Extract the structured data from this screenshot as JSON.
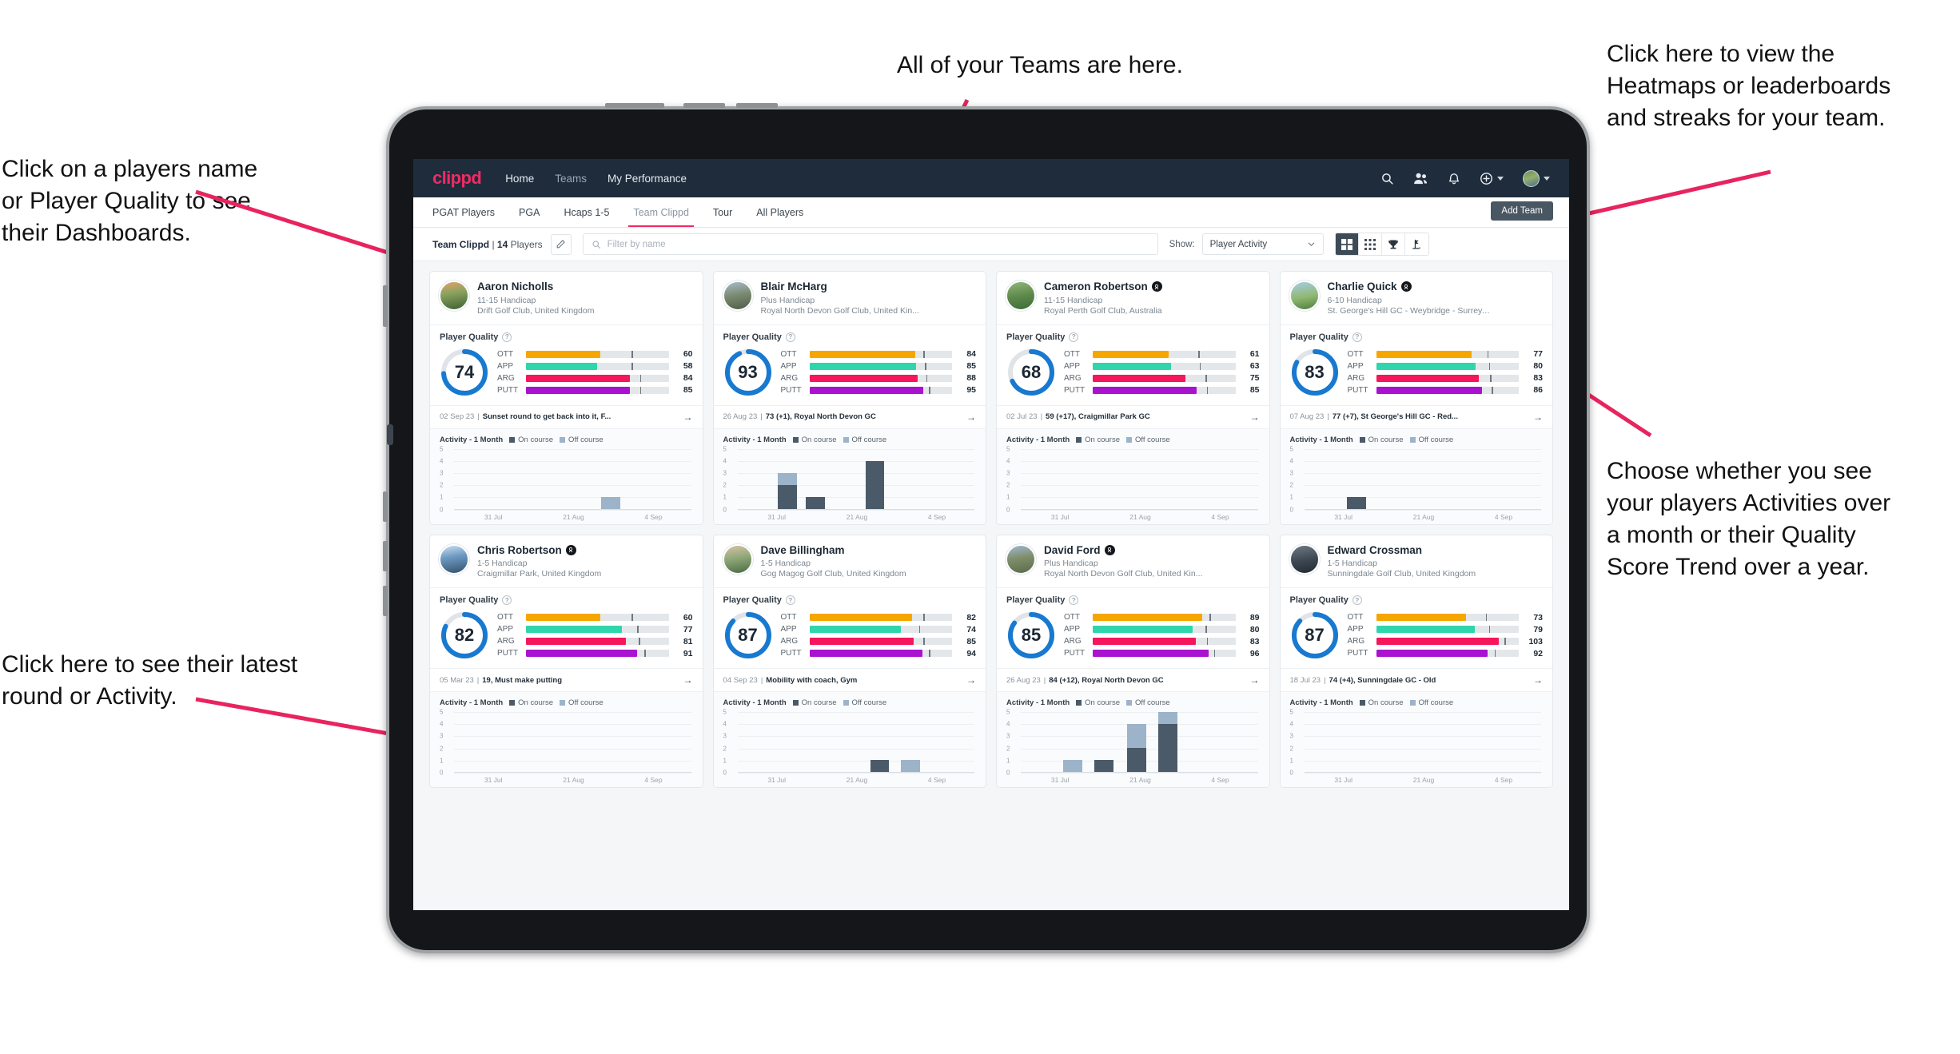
{
  "annotations": {
    "top": "All of your Teams are here.",
    "left_top": "Click on a players name\nor Player Quality to see\ntheir Dashboards.",
    "left_bottom": "Click here to see their latest\nround or Activity.",
    "right_top": "Click here to view the\nHeatmaps or leaderboards\nand streaks for your team.",
    "right_bottom": "Choose whether you see\nyour players Activities over\na month or their Quality\nScore Trend over a year."
  },
  "topnav": {
    "brand": "clippd",
    "links": [
      {
        "label": "Home",
        "active": true
      },
      {
        "label": "Teams",
        "active": false
      },
      {
        "label": "My Performance",
        "active": true
      }
    ],
    "icons": [
      "search-icon",
      "people-icon",
      "bell-icon",
      "plus-circle-icon",
      "avatar"
    ]
  },
  "tabs": [
    {
      "label": "PGAT Players",
      "active": false
    },
    {
      "label": "PGA",
      "active": false
    },
    {
      "label": "Hcaps 1-5",
      "active": false
    },
    {
      "label": "Team Clippd",
      "active": true
    },
    {
      "label": "Tour",
      "active": false
    },
    {
      "label": "All Players",
      "active": false
    }
  ],
  "add_team_label": "Add Team",
  "filterbar": {
    "team_name": "Team Clippd",
    "separator": " | ",
    "player_count": "14",
    "players_word": " Players",
    "search_placeholder": "Filter by name",
    "search_value": "",
    "show_label": "Show:",
    "show_value": "Player Activity",
    "views": [
      {
        "name": "grid-view-icon",
        "active": true
      },
      {
        "name": "dots-grid-view-icon",
        "active": false
      },
      {
        "name": "trophy-view-icon",
        "active": false
      },
      {
        "name": "golf-flag-view-icon",
        "active": false
      }
    ]
  },
  "labels": {
    "player_quality": "Player Quality",
    "activity": "Activity - 1 Month",
    "legend_on": "On course",
    "legend_off": "Off course"
  },
  "colors": {
    "brand_pink": "#ef2b64",
    "nav_bg": "#1e2c3c",
    "donut_blue": "#1879d0",
    "ott": "#f5a700",
    "app": "#2fd6ab",
    "arg": "#f5165c",
    "putt": "#a913cf",
    "on_course": "#4a5a68",
    "off_course": "#9cb3c9"
  },
  "chart_data": {
    "type": "bar",
    "title": "Activity - 1 Month",
    "xlabel": "",
    "ylabel": "",
    "ylim": [
      0,
      5
    ],
    "yticks": [
      0,
      1,
      2,
      3,
      4,
      5
    ],
    "tick_labels": [
      "31 Jul",
      "21 Aug",
      "4 Sep"
    ],
    "grid": true,
    "legend": [
      "On course",
      "Off course"
    ],
    "stacked": true,
    "series_colors": {
      "On course": "#4a5a68",
      "Off course": "#9cb3c9"
    }
  },
  "players": [
    {
      "name": "Aaron Nicholls",
      "verified": false,
      "handicap": "11-15 Handicap",
      "club": "Drift Golf Club, United Kingdom",
      "quality": 74,
      "metrics": [
        {
          "label": "OTT",
          "value": 60,
          "fill": 52,
          "tick": 74,
          "color": "#f5a700"
        },
        {
          "label": "APP",
          "value": 58,
          "fill": 50,
          "tick": 74,
          "color": "#2fd6ab"
        },
        {
          "label": "ARG",
          "value": 84,
          "fill": 73,
          "tick": 80,
          "color": "#f5165c"
        },
        {
          "label": "PUTT",
          "value": 85,
          "fill": 73,
          "tick": 80,
          "color": "#a913cf"
        }
      ],
      "round_date": "02 Sep 23",
      "round_text": "Sunset round to get back into it, F...",
      "bars": [
        {
          "pos": 62,
          "on": 0,
          "off": 1
        }
      ]
    },
    {
      "name": "Blair McHarg",
      "verified": false,
      "handicap": "Plus Handicap",
      "club": "Royal North Devon Golf Club, United Kin...",
      "quality": 93,
      "metrics": [
        {
          "label": "OTT",
          "value": 84,
          "fill": 74,
          "tick": 80,
          "color": "#f5a700"
        },
        {
          "label": "APP",
          "value": 85,
          "fill": 75,
          "tick": 81,
          "color": "#2fd6ab"
        },
        {
          "label": "ARG",
          "value": 88,
          "fill": 76,
          "tick": 82,
          "color": "#f5165c"
        },
        {
          "label": "PUTT",
          "value": 95,
          "fill": 80,
          "tick": 84,
          "color": "#a913cf"
        }
      ],
      "round_date": "26 Aug 23",
      "round_text": "73 (+1), Royal North Devon GC",
      "round_bold_head": "73 (+1), Royal North Devon GC",
      "bars": [
        {
          "pos": 17,
          "on": 2,
          "off": 1
        },
        {
          "pos": 29,
          "on": 1,
          "off": 0
        },
        {
          "pos": 54,
          "on": 4,
          "off": 0
        }
      ]
    },
    {
      "name": "Cameron Robertson",
      "verified": true,
      "handicap": "11-15 Handicap",
      "club": "Royal Perth Golf Club, Australia",
      "quality": 68,
      "metrics": [
        {
          "label": "OTT",
          "value": 61,
          "fill": 53,
          "tick": 74,
          "color": "#f5a700"
        },
        {
          "label": "APP",
          "value": 63,
          "fill": 55,
          "tick": 75,
          "color": "#2fd6ab"
        },
        {
          "label": "ARG",
          "value": 75,
          "fill": 65,
          "tick": 79,
          "color": "#f5165c"
        },
        {
          "label": "PUTT",
          "value": 85,
          "fill": 73,
          "tick": 80,
          "color": "#a913cf"
        }
      ],
      "round_date": "02 Jul 23",
      "round_text": "59 (+17), Craigmillar Park GC",
      "bars": []
    },
    {
      "name": "Charlie Quick",
      "verified": true,
      "handicap": "6-10 Handicap",
      "club": "St. George's Hill GC - Weybridge - Surrey, ...",
      "quality": 83,
      "metrics": [
        {
          "label": "OTT",
          "value": 77,
          "fill": 67,
          "tick": 78,
          "color": "#f5a700"
        },
        {
          "label": "APP",
          "value": 80,
          "fill": 70,
          "tick": 79,
          "color": "#2fd6ab"
        },
        {
          "label": "ARG",
          "value": 83,
          "fill": 72,
          "tick": 80,
          "color": "#f5165c"
        },
        {
          "label": "PUTT",
          "value": 86,
          "fill": 74,
          "tick": 81,
          "color": "#a913cf"
        }
      ],
      "round_date": "07 Aug 23",
      "round_text": "77 (+7), St George's Hill GC - Red...",
      "bars": [
        {
          "pos": 18,
          "on": 1,
          "off": 0
        }
      ]
    },
    {
      "name": "Chris Robertson",
      "verified": true,
      "handicap": "1-5 Handicap",
      "club": "Craigmillar Park, United Kingdom",
      "quality": 82,
      "metrics": [
        {
          "label": "OTT",
          "value": 60,
          "fill": 52,
          "tick": 74,
          "color": "#f5a700"
        },
        {
          "label": "APP",
          "value": 77,
          "fill": 67,
          "tick": 78,
          "color": "#2fd6ab"
        },
        {
          "label": "ARG",
          "value": 81,
          "fill": 70,
          "tick": 79,
          "color": "#f5165c"
        },
        {
          "label": "PUTT",
          "value": 91,
          "fill": 78,
          "tick": 83,
          "color": "#a913cf"
        }
      ],
      "round_date": "05 Mar 23",
      "round_text": "19, Must make putting",
      "bars": []
    },
    {
      "name": "Dave Billingham",
      "verified": false,
      "handicap": "1-5 Handicap",
      "club": "Gog Magog Golf Club, United Kingdom",
      "quality": 87,
      "metrics": [
        {
          "label": "OTT",
          "value": 82,
          "fill": 72,
          "tick": 80,
          "color": "#f5a700"
        },
        {
          "label": "APP",
          "value": 74,
          "fill": 64,
          "tick": 77,
          "color": "#2fd6ab"
        },
        {
          "label": "ARG",
          "value": 85,
          "fill": 73,
          "tick": 80,
          "color": "#f5165c"
        },
        {
          "label": "PUTT",
          "value": 94,
          "fill": 79,
          "tick": 84,
          "color": "#a913cf"
        }
      ],
      "round_date": "04 Sep 23",
      "round_text": "Mobility with coach, Gym",
      "bars": [
        {
          "pos": 56,
          "on": 1,
          "off": 0
        },
        {
          "pos": 69,
          "on": 0,
          "off": 1
        }
      ]
    },
    {
      "name": "David Ford",
      "verified": true,
      "handicap": "Plus Handicap",
      "club": "Royal North Devon Golf Club, United Kin...",
      "quality": 85,
      "metrics": [
        {
          "label": "OTT",
          "value": 89,
          "fill": 77,
          "tick": 82,
          "color": "#f5a700"
        },
        {
          "label": "APP",
          "value": 80,
          "fill": 70,
          "tick": 79,
          "color": "#2fd6ab"
        },
        {
          "label": "ARG",
          "value": 83,
          "fill": 72,
          "tick": 80,
          "color": "#f5165c"
        },
        {
          "label": "PUTT",
          "value": 96,
          "fill": 81,
          "tick": 85,
          "color": "#a913cf"
        }
      ],
      "round_date": "26 Aug 23",
      "round_text": "84 (+12), Royal North Devon GC",
      "bars": [
        {
          "pos": 18,
          "on": 0,
          "off": 1
        },
        {
          "pos": 31,
          "on": 1,
          "off": 0
        },
        {
          "pos": 45,
          "on": 2,
          "off": 2
        },
        {
          "pos": 58,
          "on": 4,
          "off": 1
        }
      ]
    },
    {
      "name": "Edward Crossman",
      "verified": false,
      "handicap": "1-5 Handicap",
      "club": "Sunningdale Golf Club, United Kingdom",
      "quality": 87,
      "metrics": [
        {
          "label": "OTT",
          "value": 73,
          "fill": 63,
          "tick": 77,
          "color": "#f5a700"
        },
        {
          "label": "APP",
          "value": 79,
          "fill": 69,
          "tick": 79,
          "color": "#2fd6ab"
        },
        {
          "label": "ARG",
          "value": 103,
          "fill": 86,
          "tick": 90,
          "color": "#f5165c"
        },
        {
          "label": "PUTT",
          "value": 92,
          "fill": 78,
          "tick": 83,
          "color": "#a913cf"
        }
      ],
      "round_date": "18 Jul 23",
      "round_text": "74 (+4), Sunningdale GC - Old",
      "bars": []
    }
  ]
}
